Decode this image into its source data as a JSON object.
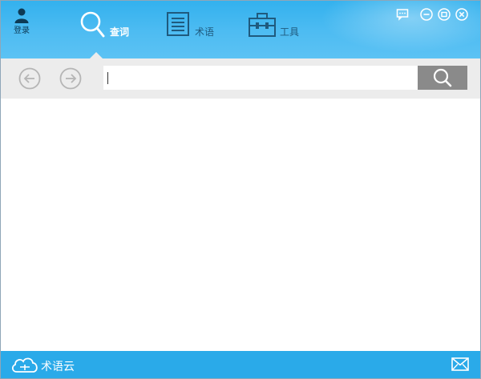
{
  "header": {
    "login_label": "登录",
    "tabs": [
      {
        "id": "search",
        "label": "查词",
        "icon": "magnifier-icon",
        "active": true
      },
      {
        "id": "terms",
        "label": "术语",
        "icon": "document-icon",
        "active": false
      },
      {
        "id": "tools",
        "label": "工具",
        "icon": "toolbox-icon",
        "active": false
      }
    ],
    "window_controls": [
      "feedback-icon",
      "minimize-icon",
      "maximize-icon",
      "close-icon"
    ]
  },
  "search": {
    "value": "",
    "placeholder": ""
  },
  "footer": {
    "brand_label": "术语云"
  },
  "colors": {
    "header": "#3ab5ef",
    "footer": "#2aaae9",
    "search_button": "#8a8a8a",
    "toolbar": "#ececec"
  }
}
